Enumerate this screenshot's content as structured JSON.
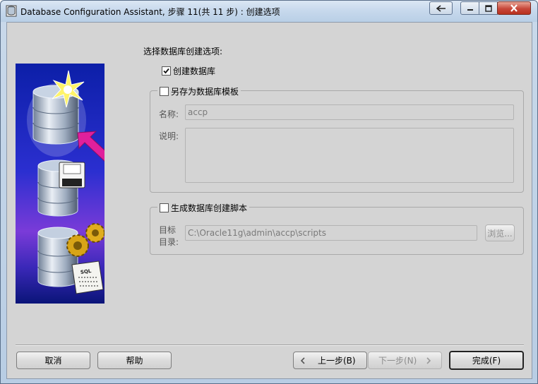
{
  "window": {
    "title": "Database Configuration Assistant, 步骤 11(共 11 步) : 创建选项"
  },
  "titlebar_controls": [
    "back-icon",
    "minimize-icon",
    "maximize-icon",
    "close-icon"
  ],
  "prompt": "选择数据库创建选项:",
  "options": {
    "create_database": {
      "label": "创建数据库",
      "checked": true
    },
    "save_template": {
      "label": "另存为数据库模板",
      "checked": false
    },
    "generate_scripts": {
      "label": "生成数据库创建脚本",
      "checked": false
    }
  },
  "template": {
    "name_label": "名称:",
    "name_value": "accp",
    "desc_label": "说明:",
    "desc_value": ""
  },
  "scripts": {
    "dest_label_line1": "目标",
    "dest_label_line2": "目录:",
    "dest_value": "C:\\Oracle11g\\admin\\accp\\scripts",
    "browse_label": "浏览..."
  },
  "buttons": {
    "cancel": "取消",
    "help": "帮助",
    "back": "上一步(B)",
    "next": "下一步(N)",
    "finish": "完成(F)"
  },
  "banner_text": "SQL",
  "colors": {
    "banner_blue": "#1a2fae",
    "arrow_magenta": "#e0209c",
    "dialog_bg": "#d4d4d4"
  }
}
